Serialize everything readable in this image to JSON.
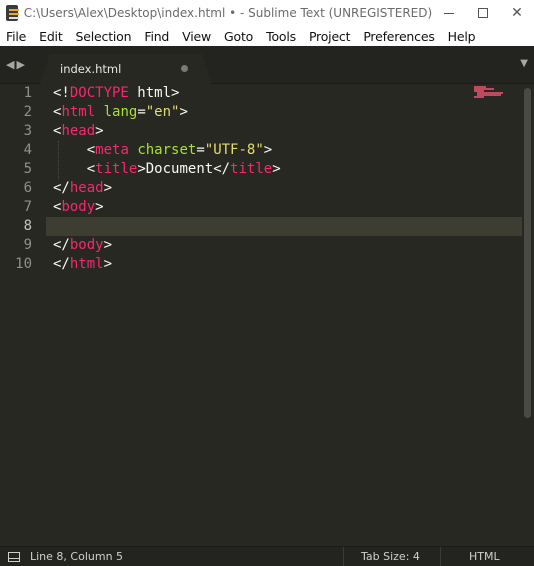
{
  "window": {
    "title": "C:\\Users\\Alex\\Desktop\\index.html • - Sublime Text (UNREGISTERED)",
    "minimize_label": "—",
    "maximize_label": "☐",
    "close_label": "✕"
  },
  "menu": [
    "File",
    "Edit",
    "Selection",
    "Find",
    "View",
    "Goto",
    "Tools",
    "Project",
    "Preferences",
    "Help"
  ],
  "tabs": {
    "nav_left": "◀",
    "nav_right": "▶",
    "active": {
      "label": "index.html",
      "modified": true
    },
    "dropdown": "▼"
  },
  "editor": {
    "current_line": 8,
    "line_numbers": [
      "1",
      "2",
      "3",
      "4",
      "5",
      "6",
      "7",
      "8",
      "9",
      "10"
    ],
    "lines": [
      [
        {
          "t": "punct",
          "v": "<!"
        },
        {
          "t": "tag",
          "v": "DOCTYPE"
        },
        {
          "t": "txt",
          "v": " html"
        },
        {
          "t": "punct",
          "v": ">"
        }
      ],
      [
        {
          "t": "punct",
          "v": "<"
        },
        {
          "t": "tag",
          "v": "html"
        },
        {
          "t": "txt",
          "v": " "
        },
        {
          "t": "attr",
          "v": "lang"
        },
        {
          "t": "punct",
          "v": "="
        },
        {
          "t": "str",
          "v": "\"en\""
        },
        {
          "t": "punct",
          "v": ">"
        }
      ],
      [
        {
          "t": "punct",
          "v": "<"
        },
        {
          "t": "tag",
          "v": "head"
        },
        {
          "t": "punct",
          "v": ">"
        }
      ],
      [
        {
          "t": "txt",
          "v": "    "
        },
        {
          "t": "punct",
          "v": "<"
        },
        {
          "t": "tag",
          "v": "meta"
        },
        {
          "t": "txt",
          "v": " "
        },
        {
          "t": "attr",
          "v": "charset"
        },
        {
          "t": "punct",
          "v": "="
        },
        {
          "t": "str",
          "v": "\"UTF-8\""
        },
        {
          "t": "punct",
          "v": ">"
        }
      ],
      [
        {
          "t": "txt",
          "v": "    "
        },
        {
          "t": "punct",
          "v": "<"
        },
        {
          "t": "tag",
          "v": "title"
        },
        {
          "t": "punct",
          "v": ">"
        },
        {
          "t": "txt",
          "v": "Document"
        },
        {
          "t": "punct",
          "v": "</"
        },
        {
          "t": "tag",
          "v": "title"
        },
        {
          "t": "punct",
          "v": ">"
        }
      ],
      [
        {
          "t": "punct",
          "v": "</"
        },
        {
          "t": "tag",
          "v": "head"
        },
        {
          "t": "punct",
          "v": ">"
        }
      ],
      [
        {
          "t": "punct",
          "v": "<"
        },
        {
          "t": "tag",
          "v": "body"
        },
        {
          "t": "punct",
          "v": ">"
        }
      ],
      [],
      [
        {
          "t": "punct",
          "v": "</"
        },
        {
          "t": "tag",
          "v": "body"
        },
        {
          "t": "punct",
          "v": ">"
        }
      ],
      [
        {
          "t": "punct",
          "v": "</"
        },
        {
          "t": "tag",
          "v": "html"
        },
        {
          "t": "punct",
          "v": ">"
        }
      ]
    ]
  },
  "status": {
    "position": "Line 8, Column 5",
    "tab_size": "Tab Size: 4",
    "syntax": "HTML"
  },
  "colors": {
    "background": "#272822",
    "tag": "#f92672",
    "attribute": "#a6e22e",
    "string": "#e6db74",
    "text": "#f8f8f2",
    "line_number": "#8f908a",
    "current_line_highlight": "#3e3d32"
  }
}
